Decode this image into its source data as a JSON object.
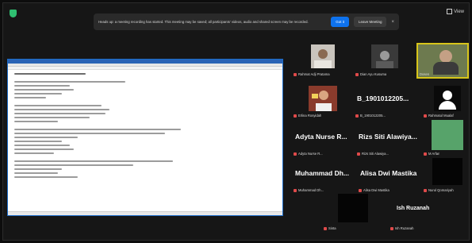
{
  "banner": {
    "message": "Heads up: a meeting recording has started. This meeting may be saved; all participants' videos, audio and shared screen may be recorded.",
    "primary_label": "Got it",
    "secondary_label": "Leave Meeting"
  },
  "topbar": {
    "view_label": "View"
  },
  "participants": [
    {
      "name": "Rahmat Adji Pratama",
      "video": "photo"
    },
    {
      "name": "Dian Ayu Kusuma",
      "video": "photo"
    },
    {
      "name": "Dosen",
      "video": "photo"
    },
    {
      "name": "Erlina Rosyidah",
      "video": "photo"
    },
    {
      "name": "B_1901012205...",
      "display": "B_1901012205...",
      "video": "text"
    },
    {
      "name": "Rahmatul Mualaf",
      "video": "avatar"
    },
    {
      "name": "Adyta Nurse R...",
      "display": "Adyta Nurse R...",
      "video": "text"
    },
    {
      "name": "Rizs Siti Alawiya...",
      "display": "Rizs Siti Alawiya...",
      "video": "text"
    },
    {
      "name": "M Arfan",
      "video": "green"
    },
    {
      "name": "Muhammad Dh...",
      "display": "Muhammad Dh...",
      "video": "text"
    },
    {
      "name": "Alisa Dwi Mastika",
      "display": "Alisa Dwi Mastika",
      "video": "text"
    },
    {
      "name": "Nurul Qomariyah",
      "video": "black"
    },
    {
      "name": "Sinta",
      "video": "black"
    },
    {
      "name": "Ish Ruzanah",
      "display": "Ish Ruzanah",
      "video": "text"
    }
  ]
}
